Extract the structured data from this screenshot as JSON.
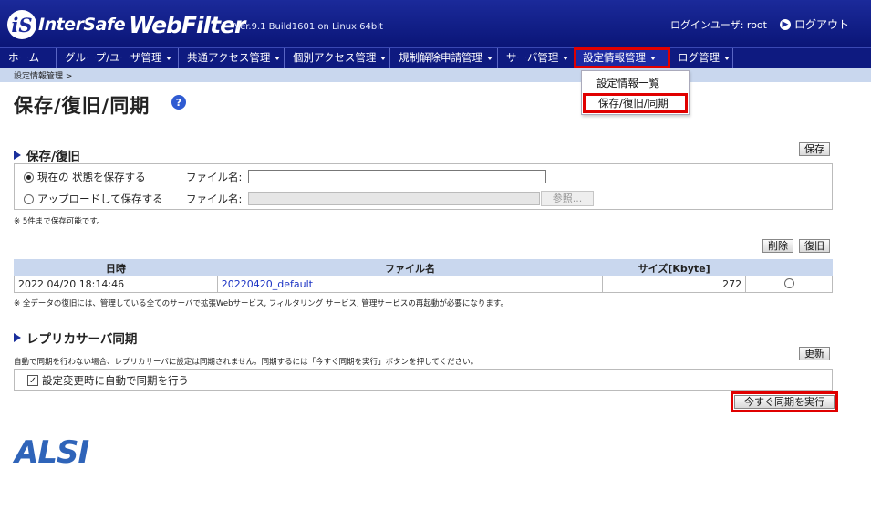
{
  "header": {
    "logo_a": "InterSafe",
    "logo_b": "WebFilter",
    "version": "Ver.9.1 Build1601 on Linux 64bit",
    "user_label": "ログインユーザ: root",
    "logout_label": "ログアウト"
  },
  "nav": {
    "items": [
      {
        "label": "ホーム"
      },
      {
        "label": "グループ/ユーザ管理"
      },
      {
        "label": "共通アクセス管理"
      },
      {
        "label": "個別アクセス管理"
      },
      {
        "label": "規制解除申請管理"
      },
      {
        "label": "サーバ管理"
      },
      {
        "label": "設定情報管理"
      },
      {
        "label": "ログ管理"
      }
    ]
  },
  "breadcrumb": "設定情報管理 >",
  "dropdown": {
    "items": [
      {
        "label": "設定情報一覧"
      },
      {
        "label": "保存/復旧/同期"
      }
    ]
  },
  "page": {
    "title": "保存/復旧/同期",
    "help_icon": "?"
  },
  "save_section": {
    "title": "保存/復旧",
    "save_button": "保存",
    "option_current": "現在の 状態を保存する",
    "option_upload": "アップロードして保存する",
    "filename_label": "ファイル名:",
    "filename_label2": "ファイル名:",
    "filename_value": "",
    "browse_button": "参照...",
    "note": "※ 5件まで保存可能です。"
  },
  "restore_section": {
    "delete_button": "削除",
    "restore_button": "復旧",
    "columns": [
      "日時",
      "ファイル名",
      "サイズ[Kbyte]"
    ],
    "rows": [
      {
        "datetime": "2022 04/20 18:14:46",
        "filename": "20220420_default",
        "size": "272"
      }
    ],
    "note": "※ 全データの復旧には、管理している全てのサーバで拡張Webサービス, フィルタリング サービス, 管理サービスの再起動が必要になります。"
  },
  "replica_section": {
    "title": "レプリカサーバ同期",
    "description": "自動で同期を行わない場合、レプリカサーバに設定は同期されません。同期するには「今すぐ同期を実行」ボタンを押してください。",
    "update_button": "更新",
    "auto_sync_label": "設定変更時に自動で同期を行う",
    "auto_sync_checked": true,
    "sync_now_button": "今すぐ同期を実行"
  },
  "footer": {
    "vendor_logo": "ALSI"
  },
  "colors": {
    "header_bg": "#0e1a80",
    "subbar_bg": "#c9d7ee",
    "highlight": "#e00000",
    "link": "#1b33c4"
  }
}
